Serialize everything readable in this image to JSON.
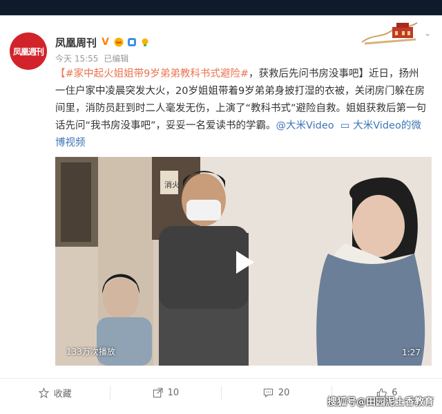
{
  "account": {
    "avatar_text": "凤凰週刊",
    "name": "凤凰周刊",
    "verified_icon": "v-verified-icon",
    "time": "今天 15:55",
    "edited": "已编辑"
  },
  "post": {
    "hashtag": "【#家中起火姐姐带9岁弟弟教科书式避险#",
    "text1": "，获救后先问书房没事吧】近日，扬州一住户家中凌晨突发大火，20岁姐姐带着9岁弟弟身披打湿的衣被，关闭房门躲在房间里，消防员赶到时二人毫发无伤，上演了“教科书式”避险自救。姐姐获救后第一句话先问“我书房没事吧”，妥妥一名爱读书的学霸。",
    "mention": "@大米Video",
    "video_link": "大米Video的微博视频"
  },
  "video": {
    "plays": "133万次播放",
    "duration": "1:27",
    "sign_text": "消火"
  },
  "actions": {
    "favorite": "收藏",
    "repost": "10",
    "comment": "20",
    "like": "6"
  },
  "watermark": "搜狐号@田园泥土香教育"
}
